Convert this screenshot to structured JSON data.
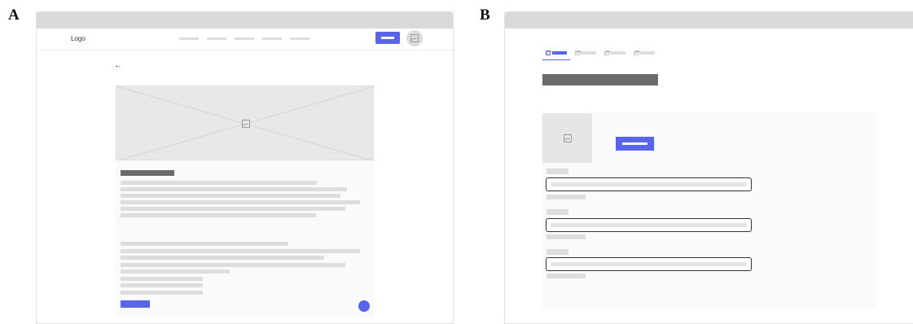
{
  "panels": [
    {
      "letter": "A",
      "header": {
        "logo_text": "Logo",
        "nav_item_count": 5
      },
      "back_icon": "arrow-left-icon",
      "hero_icon": "image-placeholder-icon",
      "avatar_icon": "image-placeholder-icon",
      "colors": {
        "accent": "#5865e8",
        "placeholder_gray": "#dddddd",
        "heading_gray": "#6b6b6b"
      }
    },
    {
      "letter": "B",
      "tabs_count": 4,
      "image_icon": "image-placeholder-icon",
      "form_field_count": 3,
      "colors": {
        "accent": "#5865e8",
        "field_border": "#333333"
      }
    }
  ]
}
